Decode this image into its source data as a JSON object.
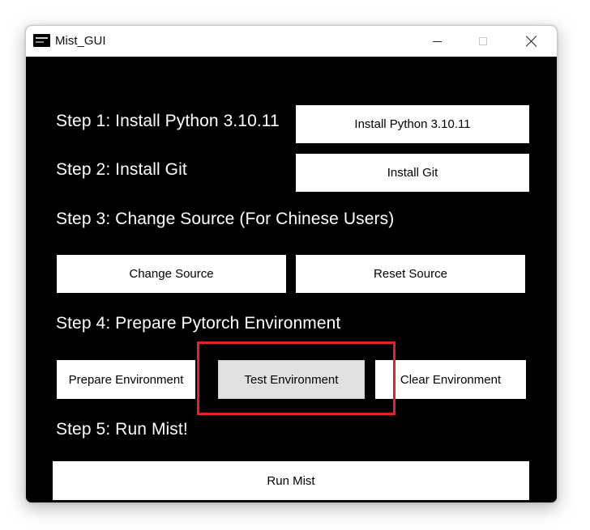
{
  "window": {
    "title": "Mist_GUI",
    "controls": {
      "minimize": "minimize",
      "maximize": "maximize",
      "close": "close"
    }
  },
  "steps": {
    "step1": {
      "label": "Step 1: Install Python 3.10.11",
      "button": "Install Python 3.10.11"
    },
    "step2": {
      "label": "Step 2: Install Git",
      "button": "Install Git"
    },
    "step3": {
      "label": "Step 3: Change Source (For Chinese Users)",
      "buttons": [
        "Change Source",
        "Reset Source"
      ]
    },
    "step4": {
      "label": "Step 4: Prepare Pytorch Environment",
      "buttons": [
        "Prepare Environment",
        "Test Environment",
        "Clear Environment"
      ]
    },
    "step5": {
      "label": "Step 5: Run Mist!",
      "button": "Run Mist"
    }
  },
  "state": {
    "highlighted_button": "Test Environment"
  },
  "colors": {
    "window_bg": "#000000",
    "button_bg": "#ffffff",
    "pressed_button_bg": "#e1e1e1",
    "highlight": "#e0232b"
  }
}
